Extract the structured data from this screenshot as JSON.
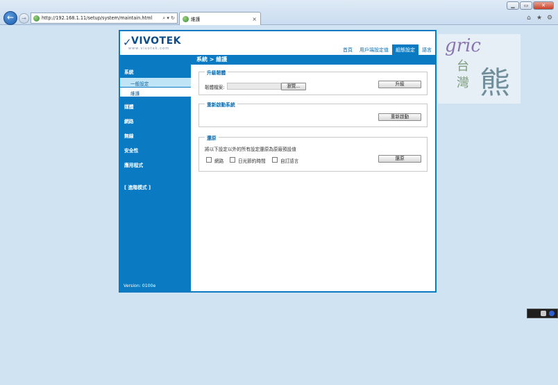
{
  "browser": {
    "url": "http://192.168.1.11/setup/system/maintain.html",
    "address_icons": "⌕ ▾ ↻",
    "tab_title": "維護",
    "tab_close": "×",
    "window_buttons": {
      "minimize": "▁",
      "maximize": "▭",
      "close": "✕"
    },
    "tools": [
      "⌂",
      "★",
      "⚙"
    ]
  },
  "header": {
    "logo": "VIVOTEK",
    "logo_sub": "www.vivotek.com",
    "nav": [
      "首頁",
      "用戶端設定值",
      "組態設定",
      "語言"
    ],
    "active_nav_index": 2
  },
  "breadcrumb": "系統  > 維護",
  "sidebar": {
    "system": "系統",
    "sub_general": "一般設定",
    "sub_maintain": "維護",
    "media": "媒體",
    "network": "網路",
    "security": "安全性",
    "wireless": "無線",
    "apps": "應用程式",
    "advanced": "[ 進階模式 ]",
    "version": "Version: 0100e"
  },
  "upgrade": {
    "legend": "升級韌體",
    "file_label": "韌體檔案:",
    "browse_label": "瀏覽...",
    "button_label": "升級"
  },
  "reboot": {
    "legend": "重新啟動系統",
    "button_label": "重新啟動"
  },
  "restore": {
    "legend": "還原",
    "description": "將以下設定以外的所有設定還原為原廠預設值",
    "options": [
      "網路",
      "日光節約時間",
      "自訂語言"
    ],
    "button_label": "還原"
  },
  "watermark": {
    "latin": "gric",
    "char1": "台",
    "char2": "灣",
    "big": "熊"
  },
  "colors": {
    "brand_blue": "#0a7ac2",
    "page_bg": "#cfe3f3"
  }
}
